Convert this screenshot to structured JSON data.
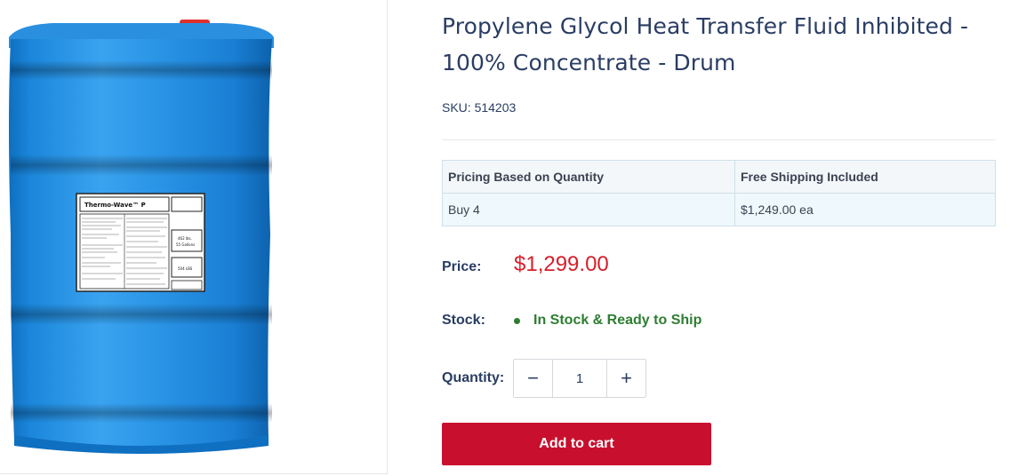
{
  "product": {
    "title": "Propylene Glycol Heat Transfer Fluid Inhibited - 100% Concentrate - Drum",
    "sku_label": "SKU:",
    "sku": "514203",
    "image": {
      "label_title": "Thermo-Wave™ P",
      "label_volume_gal_line1": "462 lbs.",
      "label_volume_gal_line2": "55 Gallons",
      "label_weight": "504 LBS"
    }
  },
  "pricing_table": {
    "headers": [
      "Pricing Based on Quantity",
      "Free Shipping Included"
    ],
    "rows": [
      [
        "Buy 4",
        "$1,249.00 ea"
      ]
    ]
  },
  "price": {
    "label": "Price:",
    "value": "$1,299.00"
  },
  "stock": {
    "label": "Stock:",
    "status": "In Stock & Ready to Ship"
  },
  "quantity": {
    "label": "Quantity:",
    "value": "1",
    "decrement": "−",
    "increment": "+"
  },
  "cart": {
    "button_label": "Add to cart"
  },
  "colors": {
    "accent_red": "#c8102e",
    "price_red": "#d71f2a",
    "stock_green": "#2e7d32",
    "text_navy": "#2a3d63",
    "drum_blue": "#1e8ee0"
  }
}
